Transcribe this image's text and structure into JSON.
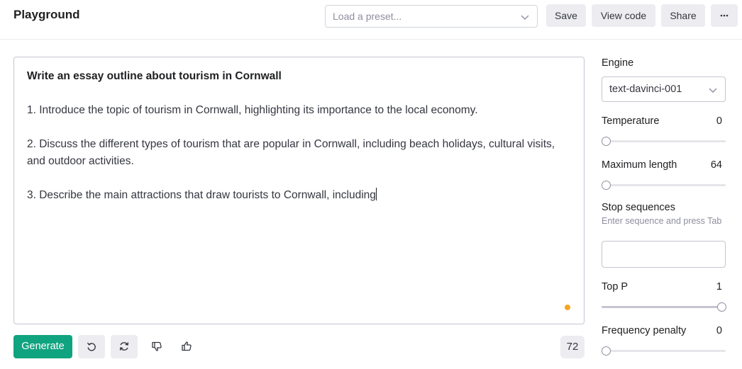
{
  "header": {
    "title": "Playground",
    "preset_placeholder": "Load a preset...",
    "buttons": {
      "save": "Save",
      "view_code": "View code",
      "share": "Share",
      "more": "···"
    }
  },
  "editor": {
    "prompt": "Write an essay outline about tourism in Cornwall",
    "paragraphs": [
      "1. Introduce the topic of tourism in Cornwall, highlighting its importance to the local economy.",
      "2. Discuss the different types of tourism that are popular in Cornwall, including beach holidays, cultural visits, and outdoor activities.",
      "3. Describe the main attractions that draw tourists to Cornwall, including"
    ],
    "status_color": "#f5a623"
  },
  "footer": {
    "generate_label": "Generate",
    "token_count": "72",
    "icons": [
      "undo-icon",
      "regenerate-icon",
      "thumbs-down-icon",
      "thumbs-up-icon"
    ]
  },
  "settings": {
    "engine": {
      "label": "Engine",
      "value": "text-davinci-001"
    },
    "temperature": {
      "label": "Temperature",
      "value": "0",
      "fraction": 0
    },
    "max_length": {
      "label": "Maximum length",
      "value": "64",
      "fraction": 0.03
    },
    "stop_sequences": {
      "label": "Stop sequences",
      "hint": "Enter sequence and press Tab"
    },
    "top_p": {
      "label": "Top P",
      "value": "1",
      "fraction": 1
    },
    "frequency_penalty": {
      "label": "Frequency penalty",
      "value": "0",
      "fraction": 0
    }
  },
  "colors": {
    "accent": "#10a37f",
    "button_bg": "#ececf1",
    "border": "#c5c5d2"
  }
}
